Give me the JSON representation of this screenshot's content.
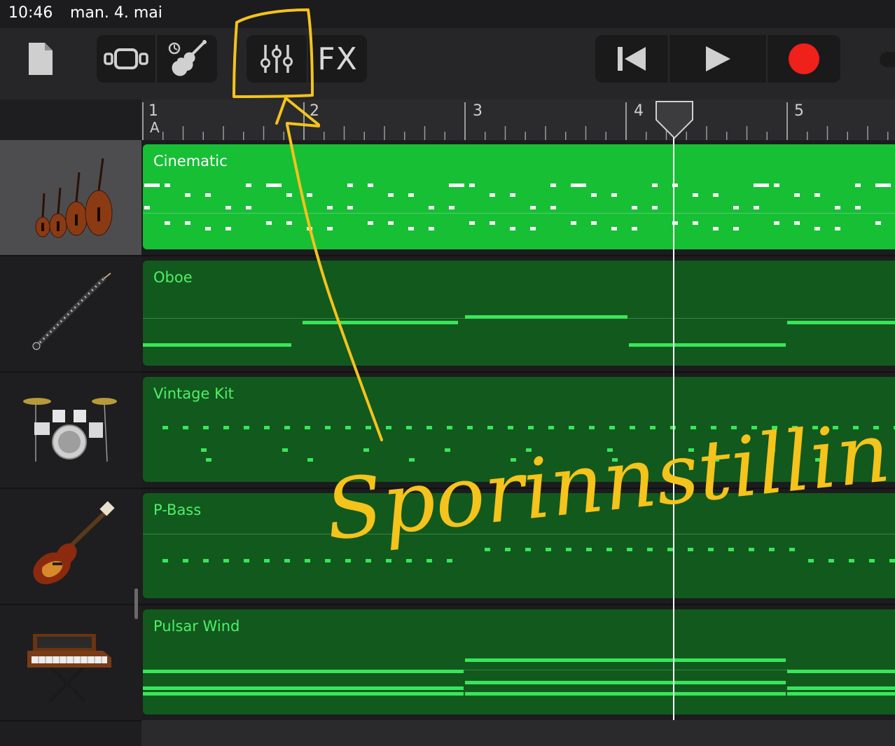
{
  "status": {
    "time": "10:46",
    "date": "man. 4. mai"
  },
  "toolbar": {
    "fx_label": "FX"
  },
  "ruler": {
    "bars": [
      "1",
      "2",
      "3",
      "4",
      "5"
    ],
    "section_marker": "A"
  },
  "tracks": [
    {
      "name": "Cinematic",
      "instrument": "string-ensemble"
    },
    {
      "name": "Oboe",
      "instrument": "oboe"
    },
    {
      "name": "Vintage Kit",
      "instrument": "drum-kit"
    },
    {
      "name": "P-Bass",
      "instrument": "bass-guitar"
    },
    {
      "name": "Pulsar Wind",
      "instrument": "synthesizer"
    }
  ],
  "annotation": {
    "text": "Sporinnstillinger"
  },
  "colors": {
    "region_active": "#17bf35",
    "region": "#12591e",
    "note": "#39e65a",
    "record": "#f0201a",
    "annotation": "#f4c31c"
  }
}
